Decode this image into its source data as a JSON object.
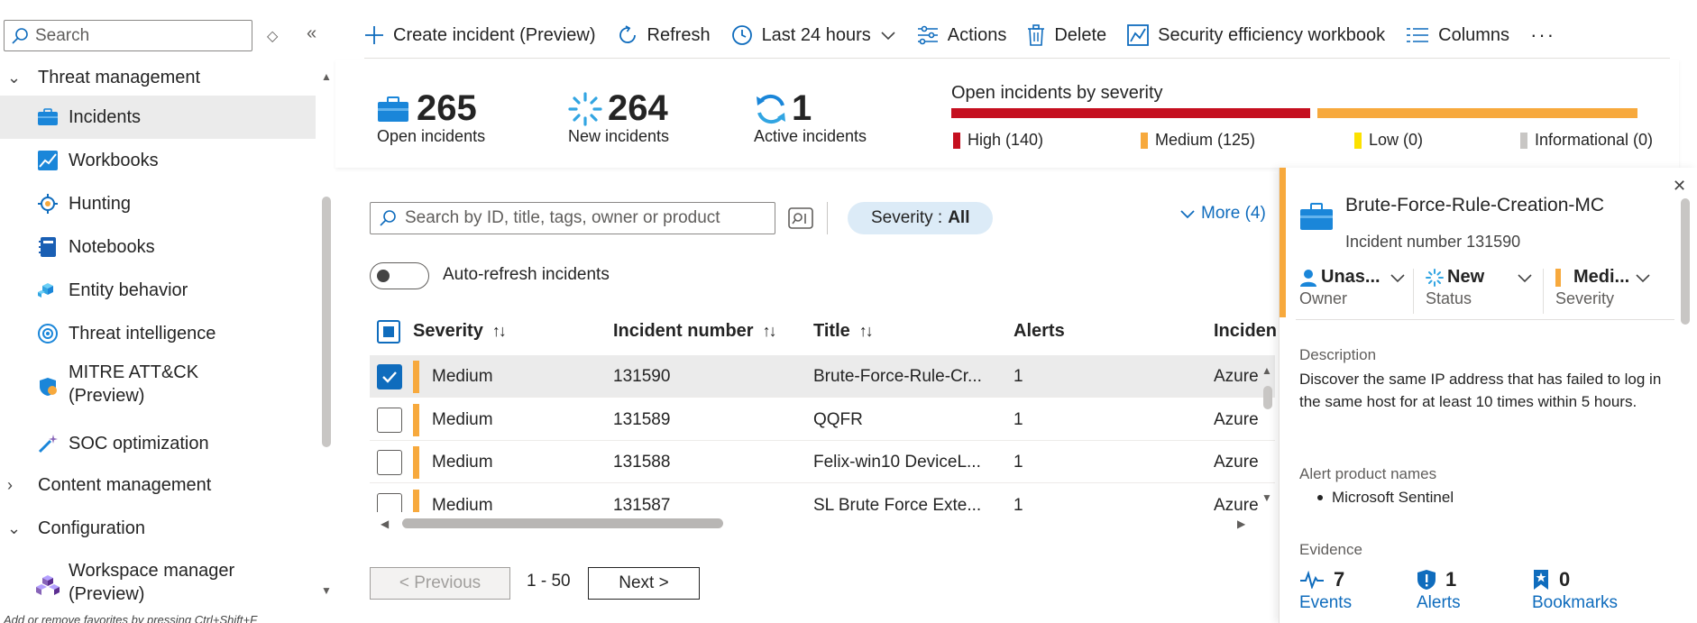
{
  "sidebar": {
    "search_placeholder": "Search",
    "groups": {
      "threat_management": "Threat management",
      "content_management": "Content management",
      "configuration": "Configuration"
    },
    "items": [
      {
        "label": "Incidents",
        "icon": "incidents-icon"
      },
      {
        "label": "Workbooks",
        "icon": "workbooks-icon"
      },
      {
        "label": "Hunting",
        "icon": "hunting-icon"
      },
      {
        "label": "Notebooks",
        "icon": "notebooks-icon"
      },
      {
        "label": "Entity behavior",
        "icon": "entity-behavior-icon"
      },
      {
        "label": "Threat intelligence",
        "icon": "threat-intelligence-icon"
      },
      {
        "label": "MITRE ATT&CK",
        "label2": "(Preview)",
        "icon": "mitre-icon"
      },
      {
        "label": "SOC optimization",
        "icon": "soc-optimization-icon"
      },
      {
        "label": "Workspace manager",
        "label2": "(Preview)",
        "icon": "workspace-manager-icon"
      }
    ],
    "footer_hint": "Add or remove favorites by pressing Ctrl+Shift+F"
  },
  "toolbar": {
    "create": "Create incident (Preview)",
    "refresh": "Refresh",
    "time_range": "Last 24 hours",
    "actions": "Actions",
    "delete": "Delete",
    "workbook": "Security efficiency workbook",
    "columns": "Columns",
    "more": "···"
  },
  "summary": {
    "open_count": "265",
    "open_label": "Open incidents",
    "new_count": "264",
    "new_label": "New incidents",
    "active_count": "1",
    "active_label": "Active incidents",
    "severity_title": "Open incidents by severity",
    "severity": {
      "high": {
        "label": "High (140)",
        "value": 140,
        "color": "#c50f1f"
      },
      "medium": {
        "label": "Medium (125)",
        "value": 125,
        "color": "#f7a93d"
      },
      "low": {
        "label": "Low (0)",
        "value": 0,
        "color": "#fce100"
      },
      "informational": {
        "label": "Informational (0)",
        "value": 0,
        "color": "#c8c6c4"
      }
    }
  },
  "filters": {
    "search_placeholder": "Search by ID, title, tags, owner or product",
    "severity_label": "Severity :",
    "severity_value": "All",
    "more": "More (4)",
    "auto_refresh": "Auto-refresh incidents"
  },
  "table": {
    "headers": {
      "severity": "Severity",
      "number": "Incident number",
      "title": "Title",
      "alerts": "Alerts",
      "product": "Incident"
    },
    "rows": [
      {
        "severity": "Medium",
        "number": "131590",
        "title": "Brute-Force-Rule-Cr...",
        "alerts": "1",
        "product": "Azure",
        "checked": true
      },
      {
        "severity": "Medium",
        "number": "131589",
        "title": "QQFR",
        "alerts": "1",
        "product": "Azure",
        "checked": false
      },
      {
        "severity": "Medium",
        "number": "131588",
        "title": "Felix-win10 DeviceL...",
        "alerts": "1",
        "product": "Azure",
        "checked": false
      },
      {
        "severity": "Medium",
        "number": "131587",
        "title": "SL  Brute Force Exte...",
        "alerts": "1",
        "product": "Azure",
        "checked": false
      }
    ]
  },
  "pagination": {
    "previous": "< Previous",
    "range": "1 - 50",
    "next": "Next >"
  },
  "detail": {
    "title": "Brute-Force-Rule-Creation-MC",
    "incident_number": "Incident number 131590",
    "owner_value": "Unas...",
    "owner_caption": "Owner",
    "status_value": "New",
    "status_caption": "Status",
    "severity_value": "Medi...",
    "severity_caption": "Severity",
    "description_label": "Description",
    "description": "Discover the same IP address that has failed to log in the same host for at least 10 times within 5 hours.",
    "alert_products_label": "Alert product names",
    "alert_product": "Microsoft Sentinel",
    "evidence_label": "Evidence",
    "events_count": "7",
    "events_label": "Events",
    "alerts_count": "1",
    "alerts_label": "Alerts",
    "bookmarks_count": "0",
    "bookmarks_label": "Bookmarks"
  }
}
